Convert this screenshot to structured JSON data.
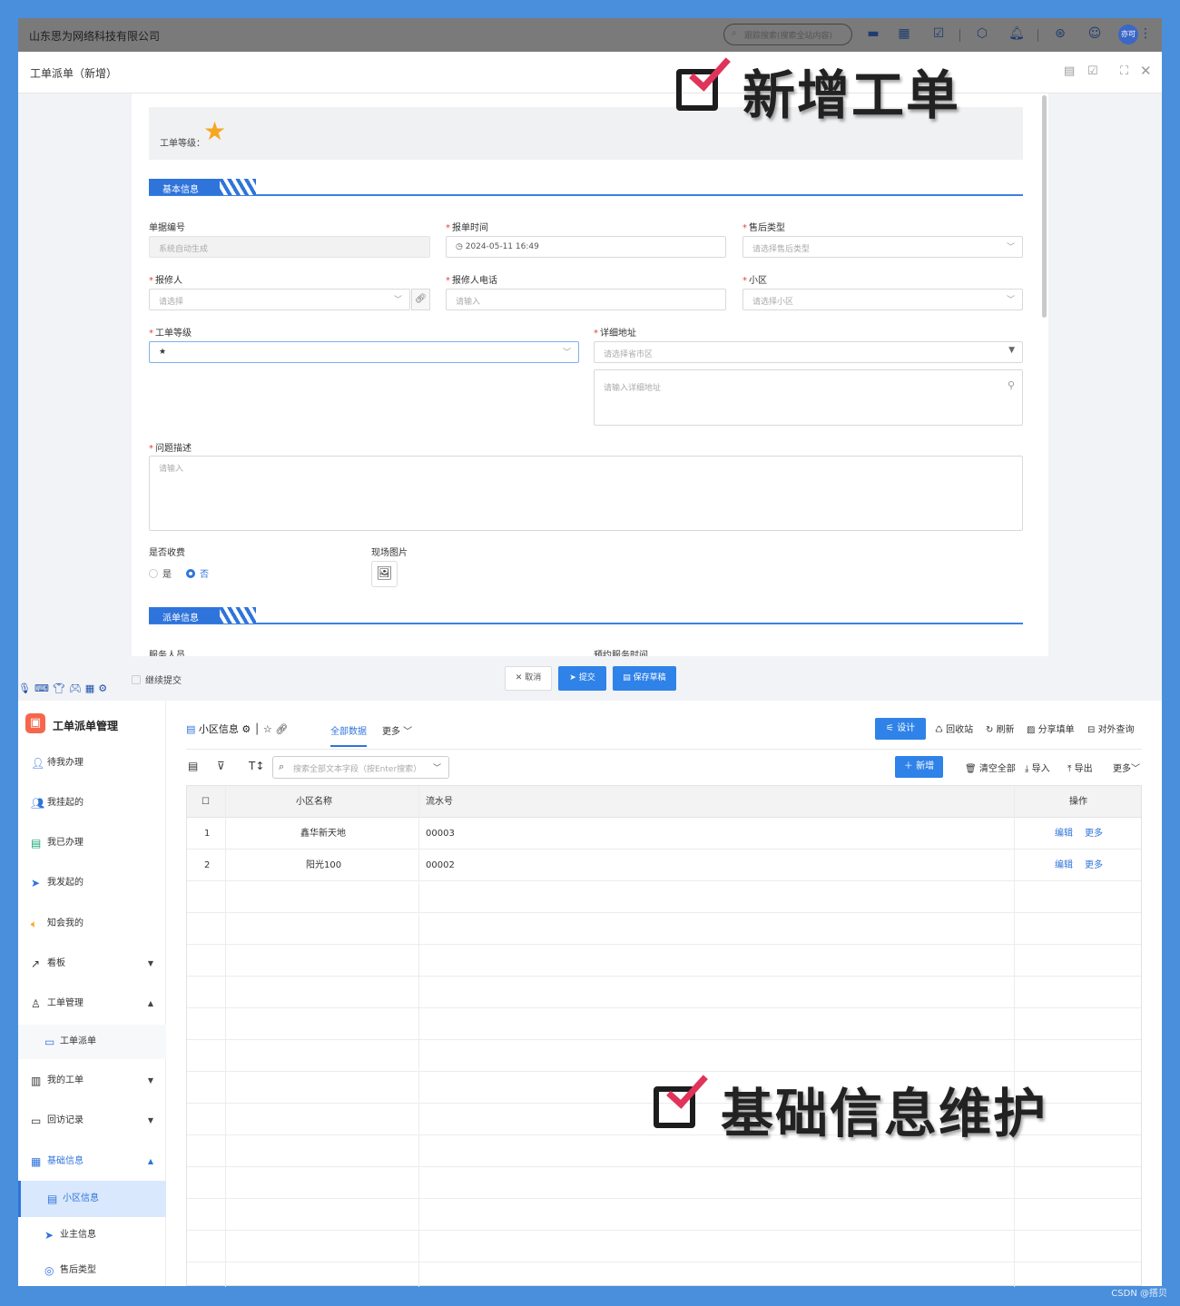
{
  "topbar": {
    "company": "山东思为网络科技有限公司",
    "search_placeholder": "跟踪搜索(搜索全站内容)",
    "avatar_text": "亦可"
  },
  "modal": {
    "title": "工单派单（新增）",
    "level_label": "工单等级：",
    "section_basic": "基本信息",
    "section_dispatch": "派单信息",
    "fields": {
      "doc_no_label": "单据编号",
      "doc_no_value": "系统自动生成",
      "report_time_label": "报单时间",
      "report_time_value": "2024-05-11 16:49",
      "aftersale_type_label": "售后类型",
      "aftersale_type_placeholder": "请选择售后类型",
      "reporter_label": "报修人",
      "reporter_placeholder": "请选择",
      "reporter_phone_label": "报修人电话",
      "reporter_phone_placeholder": "请输入",
      "community_label": "小区",
      "community_placeholder": "请选择小区",
      "level_field_label": "工单等级",
      "level_field_value": "★",
      "address_label": "详细地址",
      "address_region_placeholder": "请选择省市区",
      "address_detail_placeholder": "请输入详细地址",
      "problem_label": "问题描述",
      "problem_placeholder": "请输入",
      "charge_label": "是否收费",
      "charge_yes": "是",
      "charge_no": "否",
      "photo_label": "现场图片",
      "staff_label": "服务人员",
      "appointment_label": "预约服务时间"
    },
    "footer": {
      "continue_label": "继续提交",
      "cancel": "取消",
      "submit": "提交",
      "save_draft": "保存草稿"
    }
  },
  "overlay": {
    "title_top": "新增工单",
    "title_bottom": "基础信息维护"
  },
  "sidebar": {
    "app_title": "工单派单管理",
    "items": [
      {
        "label": "待我办理"
      },
      {
        "label": "我挂起的"
      },
      {
        "label": "我已办理"
      },
      {
        "label": "我发起的"
      },
      {
        "label": "知会我的"
      },
      {
        "label": "看板"
      },
      {
        "label": "工单管理"
      },
      {
        "label": "工单派单"
      },
      {
        "label": "我的工单"
      },
      {
        "label": "回访记录"
      },
      {
        "label": "基础信息"
      },
      {
        "label": "小区信息"
      },
      {
        "label": "业主信息"
      },
      {
        "label": "售后类型"
      }
    ]
  },
  "main": {
    "table_name": "小区信息",
    "tab_all": "全部数据",
    "tab_more": "更多",
    "design": "设计",
    "recycle": "回收站",
    "refresh": "刷新",
    "share": "分享填单",
    "external_query": "对外查询",
    "search_placeholder": "搜索全部文本字段（按Enter搜索）",
    "add": "新增",
    "clear_all": "清空全部",
    "import": "导入",
    "export": "导出",
    "more": "更多",
    "columns": [
      "小区名称",
      "流水号",
      "操作"
    ],
    "rows": [
      {
        "idx": "1",
        "name": "鑫华新天地",
        "serial": "00003",
        "edit": "编辑",
        "more": "更多"
      },
      {
        "idx": "2",
        "name": "阳光100",
        "serial": "00002",
        "edit": "编辑",
        "more": "更多"
      }
    ]
  },
  "watermark": "CSDN @搭贝"
}
